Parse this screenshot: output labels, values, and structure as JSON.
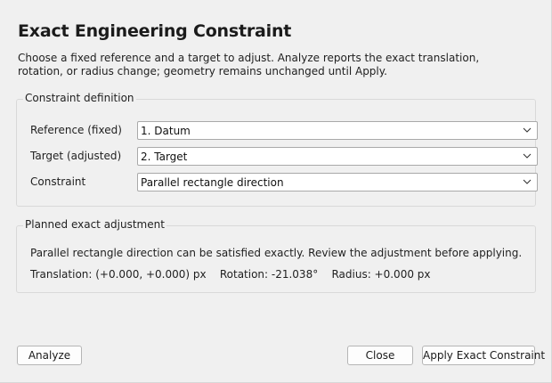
{
  "dialog": {
    "title": "Exact Engineering Constraint",
    "description": "Choose a fixed reference and a target to adjust. Analyze reports the exact translation, rotation, or radius change; geometry remains unchanged until Apply."
  },
  "definition": {
    "group_title": "Constraint definition",
    "reference": {
      "label": "Reference (fixed)",
      "value": "1. Datum"
    },
    "target": {
      "label": "Target (adjusted)",
      "value": "2. Target"
    },
    "constraint": {
      "label": "Constraint",
      "value": "Parallel rectangle direction"
    }
  },
  "result": {
    "group_title": "Planned exact adjustment",
    "message": "Parallel rectangle direction can be satisfied exactly. Review the adjustment before applying.",
    "values": "Translation: (+0.000, +0.000) px    Rotation: -21.038°    Radius: +0.000 px"
  },
  "buttons": {
    "analyze": "Analyze",
    "close": "Close",
    "apply": "Apply Exact Constraint"
  },
  "icons": {
    "dropdown": "chevron-down-icon"
  }
}
